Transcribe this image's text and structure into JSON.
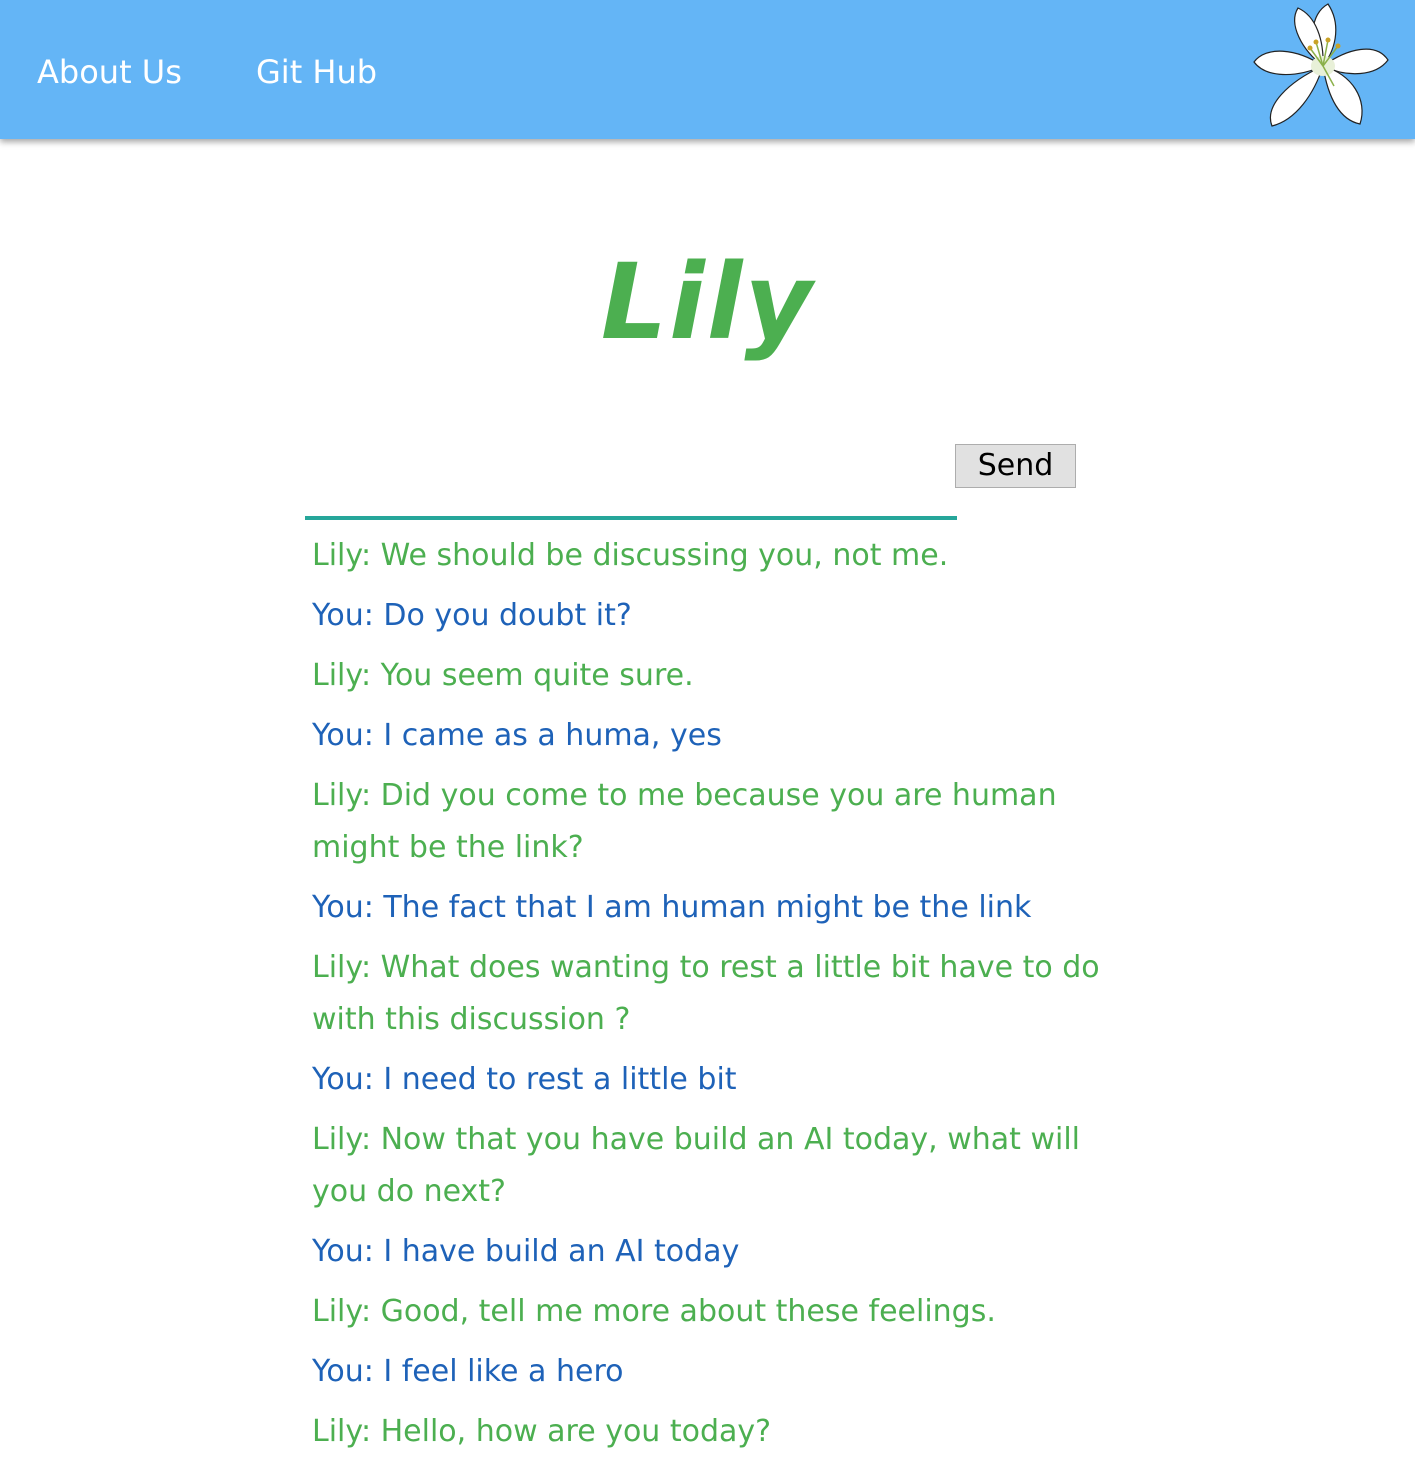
{
  "nav": {
    "about_label": "About Us",
    "github_label": "Git Hub",
    "logo_icon": "lily-flower-icon"
  },
  "title": "Lily",
  "chat": {
    "input_value": "",
    "send_label": "Send",
    "messages": [
      {
        "speaker": "lily",
        "text": "Lily: We should be discussing you, not me."
      },
      {
        "speaker": "you",
        "text": "You: Do you doubt it?"
      },
      {
        "speaker": "lily",
        "text": "Lily: You seem quite sure."
      },
      {
        "speaker": "you",
        "text": "You: I came as a huma, yes"
      },
      {
        "speaker": "lily",
        "text": "Lily: Did you come to me because you are human might be the link?"
      },
      {
        "speaker": "you",
        "text": "You: The fact that I am human might be the link"
      },
      {
        "speaker": "lily",
        "text": "Lily: What does wanting to rest a little bit have to do with this discussion ?"
      },
      {
        "speaker": "you",
        "text": "You: I need to rest a little bit"
      },
      {
        "speaker": "lily",
        "text": "Lily: Now that you have build an AI today, what will you do next?"
      },
      {
        "speaker": "you",
        "text": "You: I have build an AI today"
      },
      {
        "speaker": "lily",
        "text": "Lily: Good, tell me more about these feelings."
      },
      {
        "speaker": "you",
        "text": "You: I feel like a hero"
      },
      {
        "speaker": "lily",
        "text": "Lily: Hello, how are you today?"
      }
    ]
  },
  "colors": {
    "navbar": "#64b5f6",
    "title": "#4caf50",
    "lily_message": "#4caf50",
    "you_message": "#1e62b8",
    "input_underline": "#26a69a"
  }
}
